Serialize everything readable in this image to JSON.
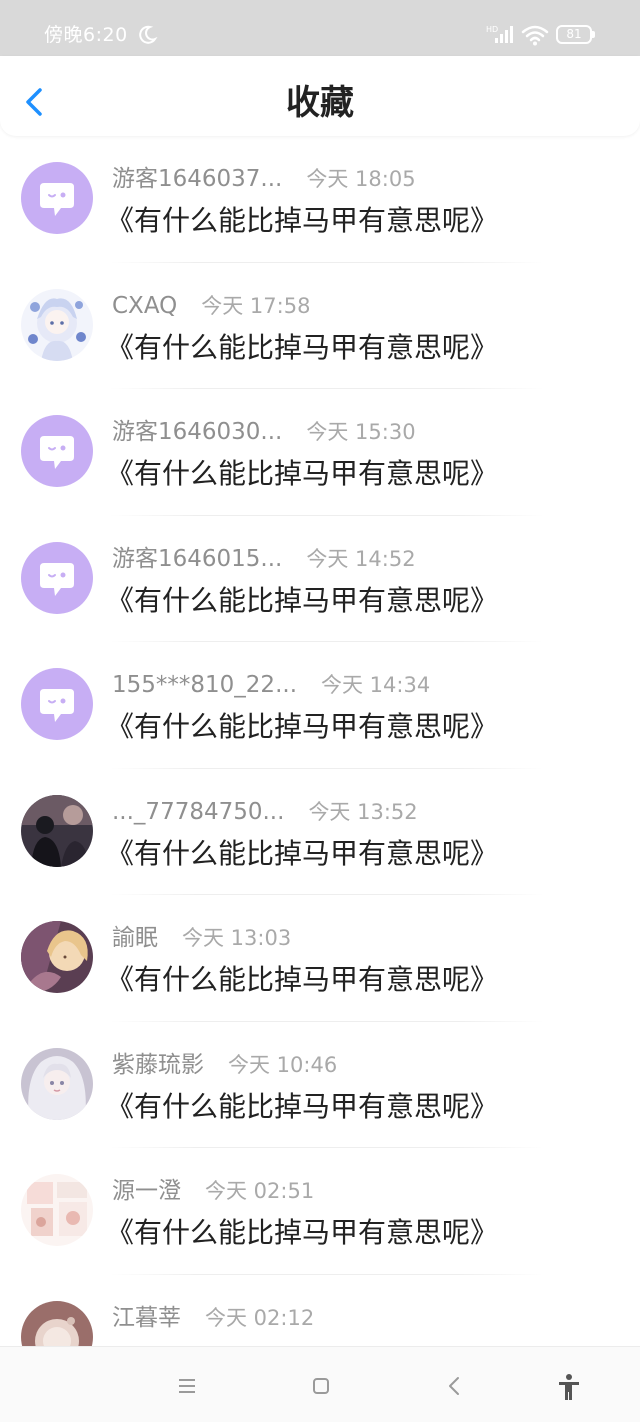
{
  "status_bar": {
    "time": "傍晚6:20",
    "battery": "81",
    "network_badge": "HD"
  },
  "header": {
    "title": "收藏"
  },
  "items": [
    {
      "username": "游客1646037...",
      "time": "今天 18:05",
      "title": "《有什么能比掉马甲有意思呢》",
      "avatar": "default"
    },
    {
      "username": "CXAQ",
      "time": "今天 17:58",
      "title": "《有什么能比掉马甲有意思呢》",
      "avatar": "anime-girl-blue"
    },
    {
      "username": "游客1646030...",
      "time": "今天 15:30",
      "title": "《有什么能比掉马甲有意思呢》",
      "avatar": "default"
    },
    {
      "username": "游客1646015...",
      "time": "今天 14:52",
      "title": "《有什么能比掉马甲有意思呢》",
      "avatar": "default"
    },
    {
      "username": "155***810_22...",
      "time": "今天 14:34",
      "title": "《有什么能比掉马甲有意思呢》",
      "avatar": "default"
    },
    {
      "username": "..._77784750...",
      "time": "今天 13:52",
      "title": "《有什么能比掉马甲有意思呢》",
      "avatar": "dark-photo"
    },
    {
      "username": "諭眠",
      "time": "今天 13:03",
      "title": "《有什么能比掉马甲有意思呢》",
      "avatar": "anime-pink"
    },
    {
      "username": "紫藤琉影",
      "time": "今天 10:46",
      "title": "《有什么能比掉马甲有意思呢》",
      "avatar": "anime-white-hair"
    },
    {
      "username": "源一澄",
      "time": "今天 02:51",
      "title": "《有什么能比掉马甲有意思呢》",
      "avatar": "comic-pastel"
    },
    {
      "username": "江暮莘",
      "time": "今天 02:12",
      "title": "",
      "avatar": "photo-pink"
    }
  ],
  "colors": {
    "accent": "#1e90ff",
    "avatar_default": "#c7aef4",
    "status_bar_bg": "#d9d9d9"
  },
  "icons": {
    "back": "chevron-left-icon",
    "moon": "moon-icon",
    "signal": "signal-icon",
    "wifi": "wifi-icon",
    "battery": "battery-icon",
    "sys_menu": "menu-icon",
    "sys_home": "home-square-icon",
    "sys_back": "back-triangle-icon",
    "accessibility": "accessibility-icon"
  }
}
